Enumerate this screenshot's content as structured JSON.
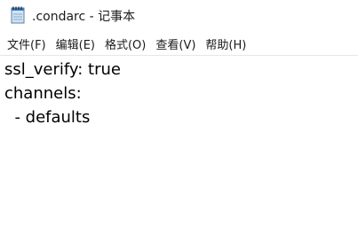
{
  "window": {
    "title": ".condarc - 记事本",
    "icon": "notepad-icon"
  },
  "menubar": {
    "items": [
      {
        "label": "文件(F)"
      },
      {
        "label": "编辑(E)"
      },
      {
        "label": "格式(O)"
      },
      {
        "label": "查看(V)"
      },
      {
        "label": "帮助(H)"
      }
    ]
  },
  "editor": {
    "lines": [
      "ssl_verify: true",
      "channels:",
      "  - defaults"
    ]
  }
}
